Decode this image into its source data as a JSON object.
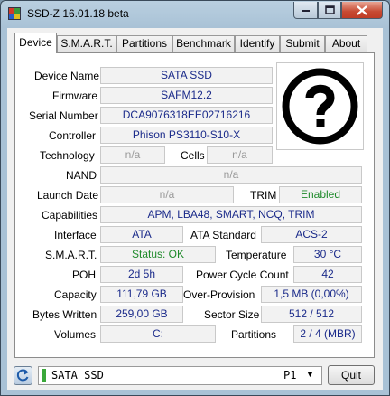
{
  "window": {
    "title": "SSD-Z 16.01.18 beta"
  },
  "tabs": [
    "Device",
    "S.M.A.R.T.",
    "Partitions",
    "Benchmark",
    "Identify",
    "Submit",
    "About"
  ],
  "device": {
    "name_label": "Device Name",
    "name_value": "SATA SSD",
    "firmware_label": "Firmware",
    "firmware_value": "SAFM12.2",
    "serial_label": "Serial Number",
    "serial_value": "DCA9076318EE02716216",
    "controller_label": "Controller",
    "controller_value": "Phison PS3110-S10-X",
    "technology_label": "Technology",
    "technology_value": "n/a",
    "cells_label": "Cells",
    "cells_value": "n/a",
    "nand_label": "NAND",
    "nand_value": "n/a",
    "launch_label": "Launch Date",
    "launch_value": "n/a",
    "trim_label": "TRIM",
    "trim_value": "Enabled",
    "capabilities_label": "Capabilities",
    "capabilities_value": "APM, LBA48, SMART, NCQ, TRIM",
    "interface_label": "Interface",
    "interface_value": "ATA",
    "ata_standard_label": "ATA Standard",
    "ata_standard_value": "ACS-2",
    "smart_label": "S.M.A.R.T.",
    "smart_value": "Status: OK",
    "temperature_label": "Temperature",
    "temperature_value": "30 °C",
    "poh_label": "POH",
    "poh_value": "2d 5h",
    "power_cycle_label": "Power Cycle Count",
    "power_cycle_value": "42",
    "capacity_label": "Capacity",
    "capacity_value": "111,79 GB",
    "over_provision_label": "Over-Provision",
    "over_provision_value": "1,5 MB (0,00%)",
    "bytes_written_label": "Bytes Written",
    "bytes_written_value": "259,00 GB",
    "sector_size_label": "Sector Size",
    "sector_size_value": "512 / 512",
    "volumes_label": "Volumes",
    "volumes_value": "C:",
    "partitions_label": "Partitions",
    "partitions_value": "2 / 4 (MBR)"
  },
  "bottom": {
    "drive_name": "SATA SSD",
    "drive_port": "P1",
    "quit_label": "Quit"
  },
  "colors": {
    "value_text": "#1a2a8a",
    "green_text": "#1e8a2a",
    "na_text": "#9a9a9a",
    "drive_indicator": "#3aa83a"
  },
  "icons": [
    "app-icon",
    "minimize-icon",
    "maximize-icon",
    "close-icon",
    "question-mark-icon",
    "refresh-icon",
    "chevron-down-icon"
  ]
}
